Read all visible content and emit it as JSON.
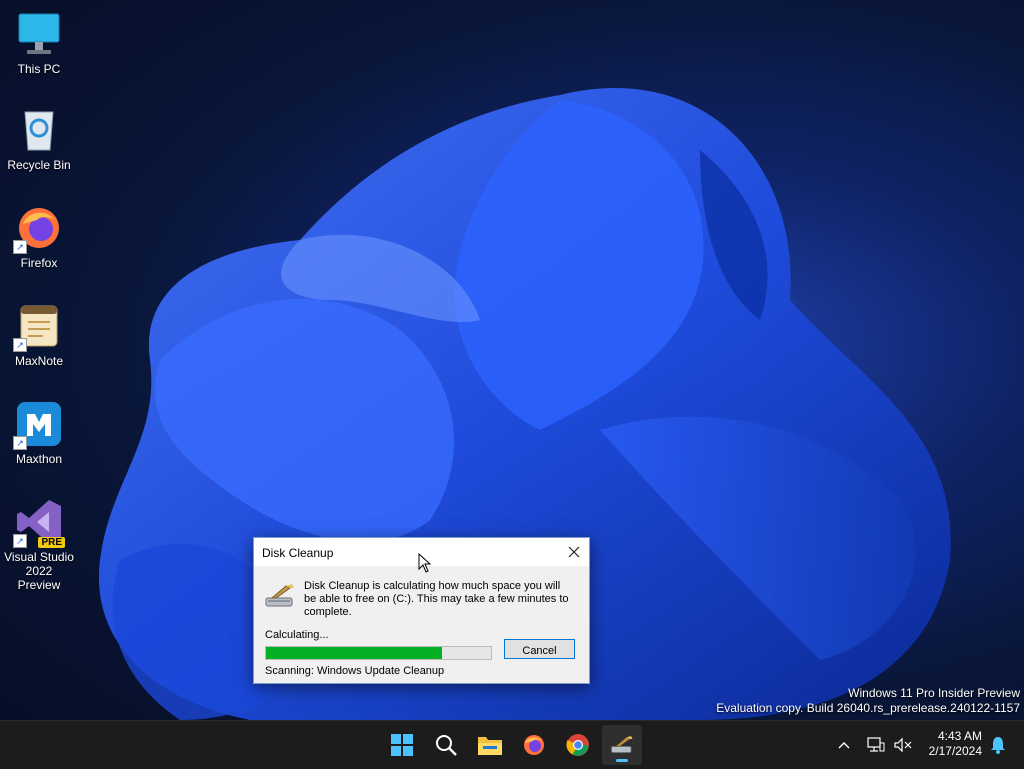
{
  "desktop": {
    "icons": [
      {
        "label": "This PC"
      },
      {
        "label": "Recycle Bin"
      },
      {
        "label": "Firefox"
      },
      {
        "label": "MaxNote"
      },
      {
        "label": "Maxthon"
      },
      {
        "label": "Visual Studio 2022 Preview",
        "badge": "PRE"
      }
    ]
  },
  "dialog": {
    "title": "Disk Cleanup",
    "message": "Disk Cleanup is calculating how much space you will be able to free on  (C:). This may take a few minutes to complete.",
    "status": "Calculating...",
    "progress_fraction": 0.78,
    "cancel_label": "Cancel",
    "scanning": "Scanning:  Windows Update Cleanup"
  },
  "watermark": {
    "line1": "Windows 11 Pro Insider Preview",
    "line2": "Evaluation copy. Build 26040.rs_prerelease.240122-1157"
  },
  "taskbar": {
    "apps": [
      "start-icon",
      "search-icon",
      "file-explorer-icon",
      "firefox-icon",
      "chrome-icon",
      "disk-cleanup-icon"
    ],
    "time": "4:43 AM",
    "date": "2/17/2024"
  },
  "colors": {
    "accent": "#0078d7",
    "progress": "#06b025",
    "taskbar": "#1c1c1c"
  }
}
